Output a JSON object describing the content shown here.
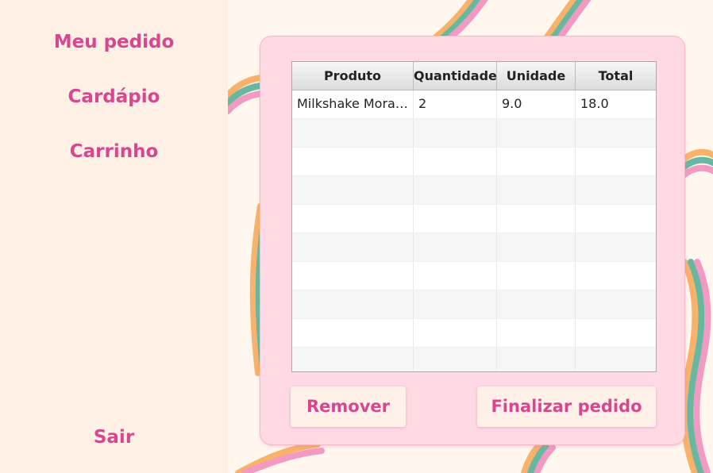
{
  "sidebar": {
    "items": [
      {
        "label": "Meu pedido"
      },
      {
        "label": "Cardápio"
      },
      {
        "label": "Carrinho"
      }
    ],
    "logout_label": "Sair"
  },
  "table": {
    "columns": [
      "Produto",
      "Quantidade",
      "Unidade",
      "Total"
    ],
    "rows": [
      [
        "Milkshake Morango",
        "2",
        "9.0",
        "18.0"
      ]
    ]
  },
  "actions": {
    "remove_label": "Remover",
    "finish_label": "Finalizar pedido"
  },
  "colors": {
    "accent": "#d8468f",
    "panel": "#ffd9e4",
    "sidebar": "#fff0e6",
    "background": "#fff6ee",
    "wave_orange": "#f8b26a",
    "wave_teal": "#67b7a1",
    "wave_pink": "#f29ac2"
  }
}
